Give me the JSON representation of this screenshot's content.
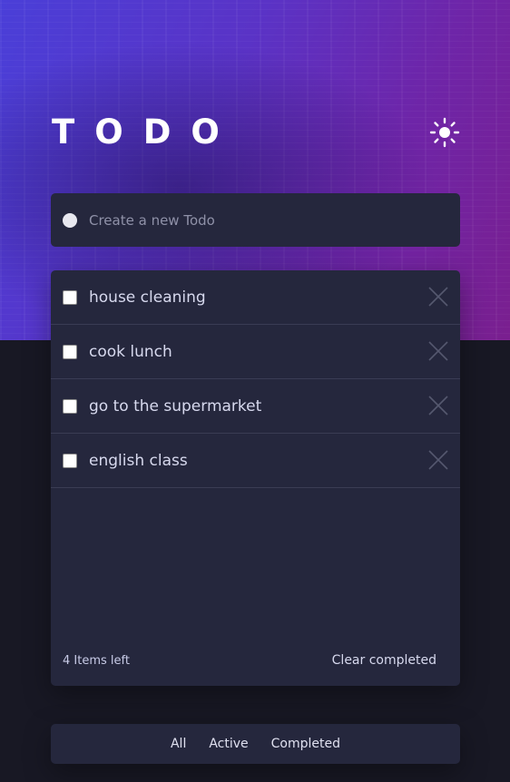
{
  "app": {
    "title": "TODO"
  },
  "theme_toggle": {
    "icon": "sun-icon"
  },
  "create": {
    "placeholder": "Create a new Todo",
    "value": ""
  },
  "todos": [
    {
      "text": "house cleaning",
      "completed": false
    },
    {
      "text": "cook lunch",
      "completed": false
    },
    {
      "text": "go to the supermarket",
      "completed": false
    },
    {
      "text": "english class",
      "completed": false
    }
  ],
  "footer": {
    "items_left": "4 Items left",
    "clear_label": "Clear completed"
  },
  "filters": {
    "all": "All",
    "active": "Active",
    "completed": "Completed"
  },
  "colors": {
    "background": "#181824",
    "card": "#25273d",
    "hero_start": "#4a3fd8",
    "hero_end": "#7a1f8f",
    "text": "#d7d9ee"
  }
}
